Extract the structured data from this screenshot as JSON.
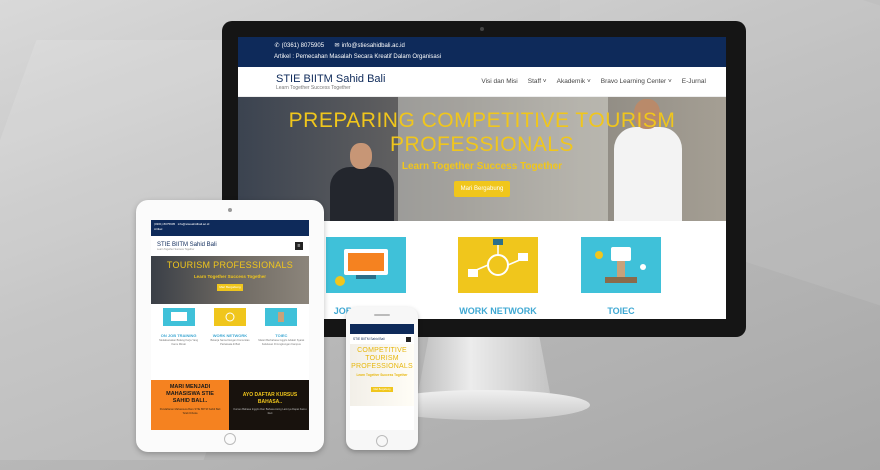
{
  "colors": {
    "navy": "#0e2a5a",
    "accent_yellow": "#f0c61c",
    "feature_blue": "#3fa8d3",
    "cta_orange": "#f58220"
  },
  "desktop": {
    "topbar": {
      "phone": "(0361) 8075905",
      "email": "info@stiesahidbali.ac.id",
      "artikel": "Artikel : Pemecahan Masalah Secara Kreatif Dalam Organisasi"
    },
    "brand": {
      "name": "STIE BIITM Sahid Bali",
      "tagline": "Learn Together Success Together"
    },
    "menu": [
      {
        "label": "Visi dan Misi"
      },
      {
        "label": "Staff ˅"
      },
      {
        "label": "Akademik ˅"
      },
      {
        "label": "Bravo Learning Center ˅"
      },
      {
        "label": "E-Jurnal"
      }
    ],
    "hero": {
      "title": "PREPARING COMPETITIVE TOURISM PROFESSIONALS",
      "subtitle": "Learn Together Success Together",
      "cta": "Mari Bergabung"
    },
    "features": [
      {
        "label": "JOB TRAINING",
        "icon": "job-training-icon"
      },
      {
        "label": "WORK NETWORK",
        "icon": "work-network-icon"
      },
      {
        "label": "TOIEC",
        "icon": "toiec-icon"
      }
    ]
  },
  "tablet": {
    "topbar": {
      "phone": "(0361) 8075905",
      "email": "info@stiesahidbali.ac.id",
      "artikel": "Artikel"
    },
    "brand": {
      "name": "STIE BIITM Sahid Bali",
      "tagline": "Learn Together Success Together"
    },
    "hero": {
      "title": "TOURISM PROFESSIONALS",
      "subtitle": "Learn Together Success Together",
      "cta": "Mari Bergabung"
    },
    "features": [
      {
        "label": "ON JOB TRAINING",
        "desc": "Melaksanakan Bidang Kerja Yang Kamu Minati"
      },
      {
        "label": "WORK NETWORK",
        "desc": "Bekerja Sama Dengan Komunitas Pariwisata di Bali"
      },
      {
        "label": "TOIEC",
        "desc": "Materi Berbahasa Inggris Adalah Syarat Kelulusan Di Lingkungan Kampus"
      }
    ],
    "cta_left": {
      "title": "MARI MENJADI MAHASISWA STIE SAHID BALI..",
      "desc": "Pendaftaran Mahasiswa Baru STIE BIITM Sahid Bali Telah Dibuka"
    },
    "cta_right": {
      "title": "AYO DAFTAR KURSUS BAHASA..",
      "desc": "Kursus Bahasa Inggris Dan Bahasa Asing Lainnya Dapat Kamu Ikuti"
    }
  },
  "phone": {
    "brand": "STIE BIITM Sahid Bali",
    "hero": {
      "title": "COMPETITIVE TOURISM PROFESSIONALS",
      "subtitle": "Learn Together Success Together",
      "cta": "Mari Bergabung"
    }
  }
}
